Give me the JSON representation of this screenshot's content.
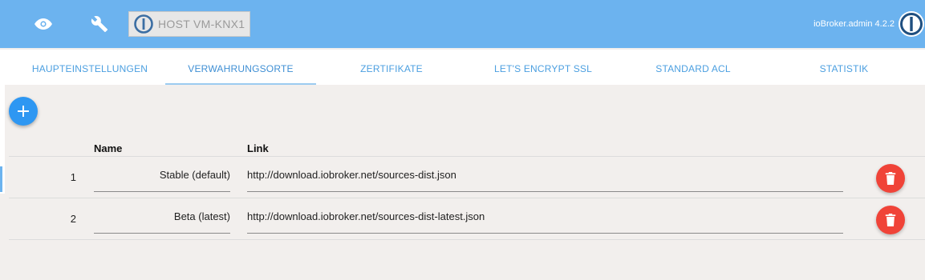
{
  "header": {
    "host_label": "HOST VM-KNX1",
    "admin_version": "ioBroker.admin 4.2.2",
    "colors": {
      "bar": "#6cb3ef",
      "accent": "#2e97f2",
      "danger": "#f04338"
    }
  },
  "tabs": [
    {
      "label": "HAUPTEINSTELLUNGEN"
    },
    {
      "label": "VERWAHRUNGSORTE",
      "active": true
    },
    {
      "label": "ZERTIFIKATE"
    },
    {
      "label": "LET'S ENCRYPT SSL"
    },
    {
      "label": "STANDARD ACL"
    },
    {
      "label": "STATISTIK"
    }
  ],
  "table": {
    "headers": {
      "name": "Name",
      "link": "Link"
    },
    "rows": [
      {
        "index": "1",
        "name": "Stable (default)",
        "link": "http://download.iobroker.net/sources-dist.json"
      },
      {
        "index": "2",
        "name": "Beta (latest)",
        "link": "http://download.iobroker.net/sources-dist-latest.json"
      }
    ]
  },
  "icons": {
    "eye": "eye-icon",
    "wrench": "wrench-icon",
    "add": "plus-icon",
    "delete": "trash-icon",
    "logo": "iobroker-logo"
  }
}
